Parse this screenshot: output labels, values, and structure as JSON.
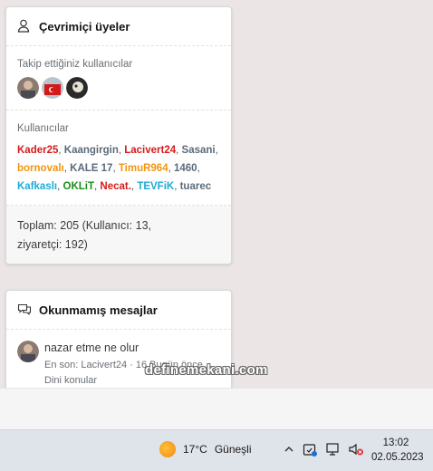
{
  "online": {
    "title": "Çevrimiçi üyeler",
    "followed_label": "Takip ettiğiniz kullanıcılar",
    "users_label": "Kullanıcılar",
    "users": [
      {
        "name": "Kader25",
        "color": "#d61a1a"
      },
      {
        "name": "Kaangirgin",
        "color": "#5b6b7a"
      },
      {
        "name": "Lacivert24",
        "color": "#d61a1a"
      },
      {
        "name": "Sasani",
        "color": "#5b6b7a"
      },
      {
        "name": "bornovalı",
        "color": "#f2960f"
      },
      {
        "name": "KALE 17",
        "color": "#5b6b7a"
      },
      {
        "name": "TimuR964",
        "color": "#f2960f"
      },
      {
        "name": "1460",
        "color": "#5b6b7a"
      },
      {
        "name": "Kafkaslı",
        "color": "#1eaad6"
      },
      {
        "name": "OKLiT",
        "color": "#1a8f1a"
      },
      {
        "name": "Necat.",
        "color": "#d61a1a"
      },
      {
        "name": "TEVFiK",
        "color": "#1eaad6"
      },
      {
        "name": "tuarec",
        "color": "#5b6b7a"
      }
    ],
    "total_line1": "Toplam: 205 (Kullanıcı: 13,",
    "total_line2": "ziyaretçi: 192)"
  },
  "unread": {
    "title": "Okunmamış mesajlar",
    "thread_title": "nazar etme ne olur",
    "thread_meta": "En son: Lacivert24 · 16 Bugün önce",
    "thread_forum": "Dini konular"
  },
  "watermark": "definemekani.com",
  "taskbar": {
    "temperature": "17°C",
    "weather": "Güneşli",
    "time": "13:02",
    "date": "02.05.2023"
  },
  "icons": [
    "user-icon",
    "chat-icon",
    "sun-icon",
    "chevron-up-icon",
    "security-icon",
    "network-icon",
    "volume-muted-icon"
  ]
}
